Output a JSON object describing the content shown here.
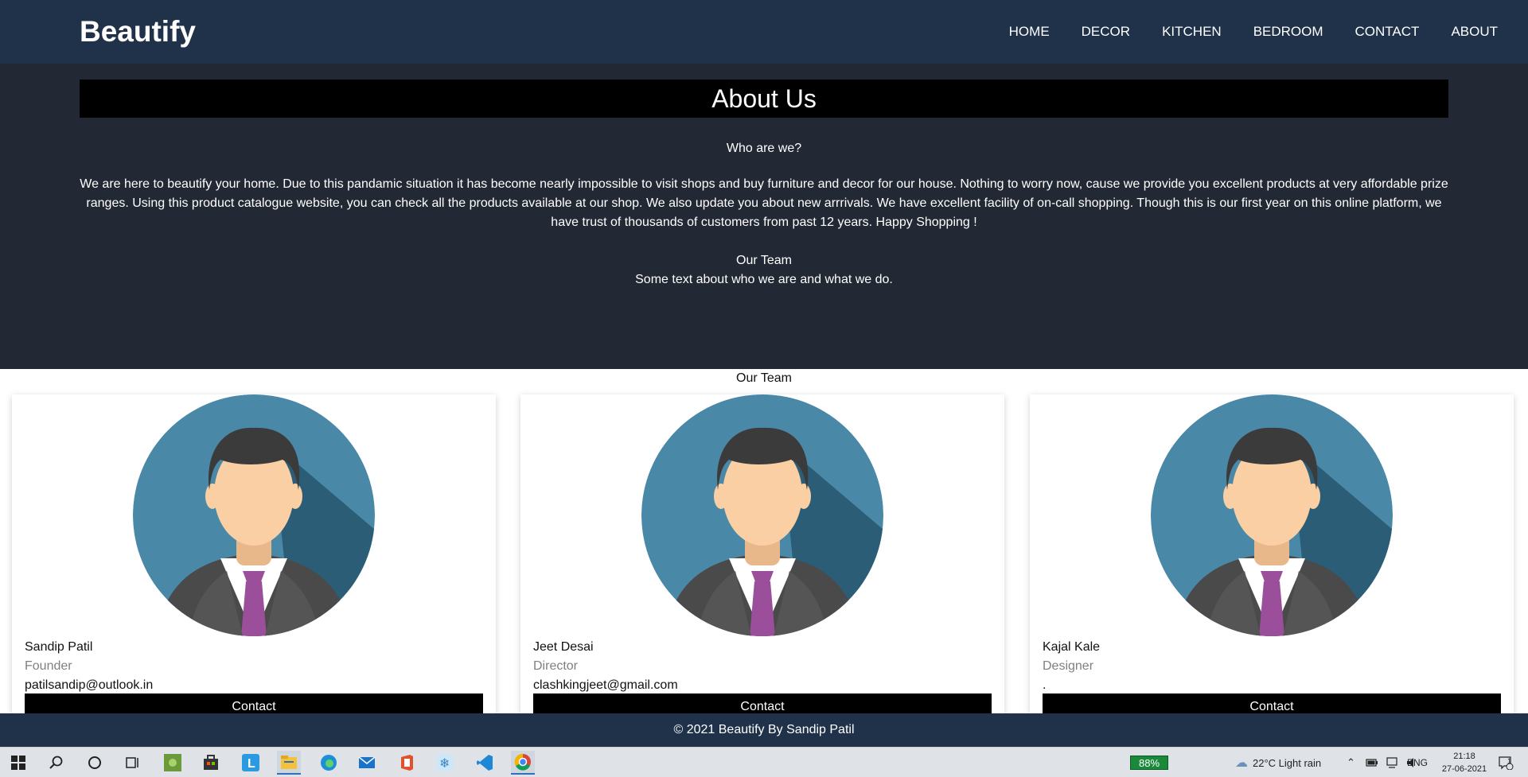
{
  "brand": {
    "name": "Beautify"
  },
  "nav": {
    "items": [
      "HOME",
      "DECOR",
      "KITCHEN",
      "BEDROOM",
      "CONTACT",
      "ABOUT"
    ]
  },
  "about": {
    "title": "About Us",
    "question": "Who are we?",
    "text": "We are here to beautify your home. Due to this pandamic situation it has become nearly impossible to visit shops and buy furniture and decor for our house. Nothing to worry now, cause we provide you excellent products at very affordable prize ranges. Using this product catalogue website, you can check all the products available at our shop. We also update you about new arrrivals. We have excellent facility of on-call shopping. Though this is our first year on this online platform, we have trust of thousands of customers from past 12 years. Happy Shopping !",
    "team_title": "Our Team",
    "team_subtitle": "Some text about who we are and what we do."
  },
  "team": {
    "label": "Our Team",
    "members": [
      {
        "name": "Sandip Patil",
        "role": "Founder",
        "email": "patilsandip@outlook.in",
        "button": "Contact"
      },
      {
        "name": "Jeet Desai",
        "role": "Director",
        "email": "clashkingjeet@gmail.com",
        "button": "Contact"
      },
      {
        "name": "Kajal Kale",
        "role": "Designer",
        "email": ".",
        "button": "Contact"
      }
    ]
  },
  "footer": {
    "text": "© 2021 Beautify By Sandip Patil"
  },
  "taskbar": {
    "battery": "88%",
    "weather": "22°C  Light rain",
    "language": "ENG",
    "time": "21:18",
    "date": "27-06-2021",
    "notification_count": "1"
  },
  "colors": {
    "navbar_bg": "#1f3249",
    "about_bg": "#222834",
    "avatar_circle": "#3f7c99",
    "tie": "#9b4f9a",
    "skin": "#f9cfa3"
  }
}
